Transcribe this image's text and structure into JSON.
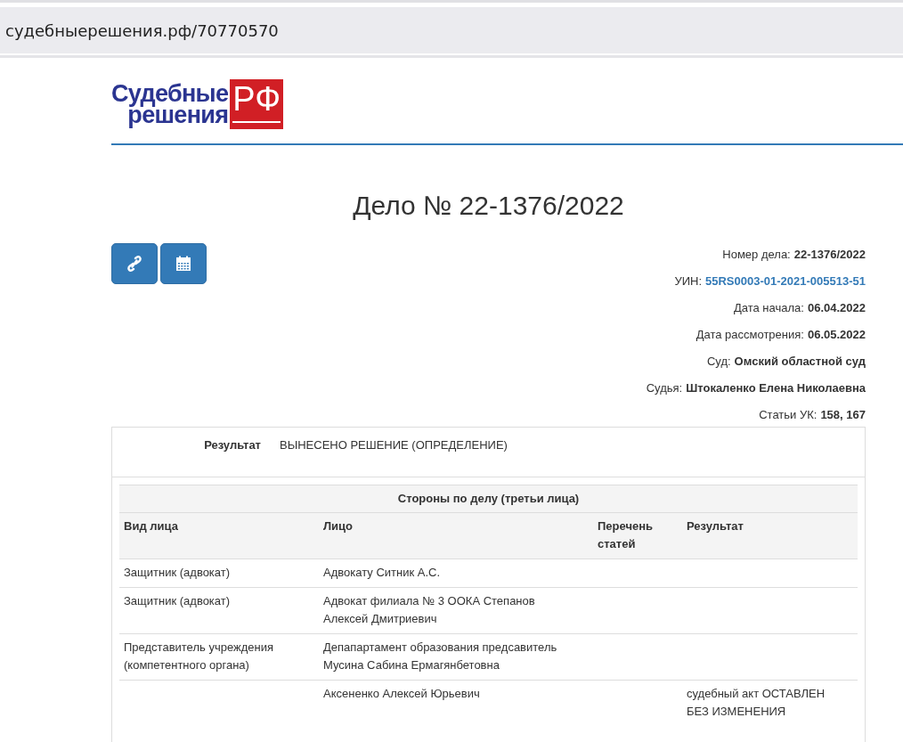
{
  "address_bar": {
    "url": "судебныерешения.рф/70770570"
  },
  "logo": {
    "line1": "Судебные",
    "line2": "решения",
    "mark": "РФ"
  },
  "title": "Дело № 22-1376/2022",
  "toolbar": [
    {
      "kind": "link"
    },
    {
      "kind": "calendar"
    }
  ],
  "details": [
    {
      "label": "Номер дела:",
      "value": "22-1376/2022",
      "link": false
    },
    {
      "label": "УИН:",
      "value": "55RS0003-01-2021-005513-51",
      "link": true
    },
    {
      "label": "Дата начала:",
      "value": "06.04.2022",
      "link": false
    },
    {
      "label": "Дата рассмотрения:",
      "value": "06.05.2022",
      "link": false
    },
    {
      "label": "Суд:",
      "value": "Омский областной суд",
      "link": false
    },
    {
      "label": "Судья:",
      "value": "Штокаленко Елена Николаевна",
      "link": false
    },
    {
      "label": "Статьи УК:",
      "value": "158, 167",
      "link": false
    }
  ],
  "result": {
    "label": "Результат",
    "value": "ВЫНЕСЕНО РЕШЕНИЕ (ОПРЕДЕЛЕНИЕ)"
  },
  "parties": {
    "caption": "Стороны по делу (третьи лица)",
    "columns": [
      "Вид лица",
      "Лицо",
      "Перечень статей",
      "Результат"
    ],
    "rows": [
      [
        "Защитник (адвокат)",
        "Адвокату Ситник А.С.",
        "",
        ""
      ],
      [
        "Защитник (адвокат)",
        "Адвокат филиала № 3 ООКА Степанов Алексей Дмитриевич",
        "",
        ""
      ],
      [
        "Представитель учреждения (компетентного органа)",
        "Депапартамент образования предсавитель Мусина Сабина Ермагянбетовна",
        "",
        ""
      ],
      [
        "",
        "Аксененко Алексей Юрьевич",
        "",
        "судебный акт ОСТАВЛЕН БЕЗ ИЗМЕНЕНИЯ"
      ]
    ]
  }
}
